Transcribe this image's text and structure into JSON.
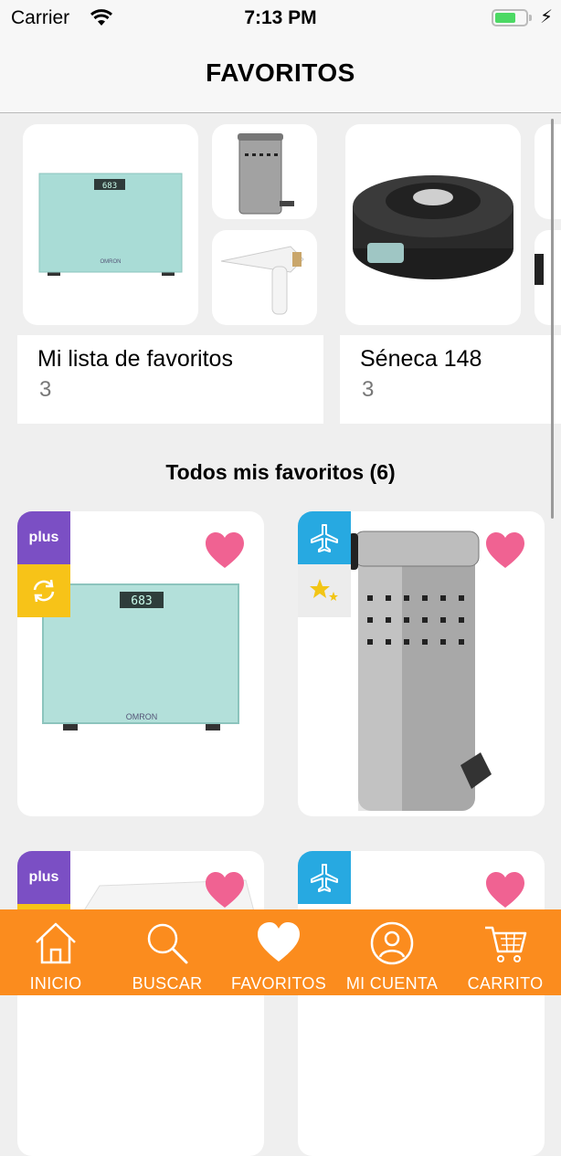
{
  "status": {
    "carrier": "Carrier",
    "time": "7:13 PM",
    "battery_level": 0.68
  },
  "header": {
    "title": "FAVORITOS"
  },
  "lists": [
    {
      "name": "Mi lista de favoritos",
      "count": "3"
    },
    {
      "name": "Séneca 148",
      "count": "3"
    }
  ],
  "section_title": "Todos mis favoritos (6)",
  "products": [
    {
      "badges": [
        "plus",
        "refresh-icon"
      ],
      "favorite": true,
      "image": "digital-bathroom-scale"
    },
    {
      "badges": [
        "airplane-icon",
        "stars-icon"
      ],
      "favorite": true,
      "image": "stainless-pedal-bin"
    },
    {
      "badges": [
        "plus"
      ],
      "favorite": true,
      "image": "plastic-container"
    },
    {
      "badges": [
        "airplane-icon"
      ],
      "favorite": true,
      "image": ""
    }
  ],
  "badge_labels": {
    "plus": "plus"
  },
  "scale_display": "683",
  "scale_brand": "OMRON",
  "tabs": [
    {
      "label": "INICIO",
      "icon": "home-icon"
    },
    {
      "label": "BUSCAR",
      "icon": "search-icon"
    },
    {
      "label": "FAVORITOS",
      "icon": "heart-icon"
    },
    {
      "label": "MI CUENTA",
      "icon": "user-icon"
    },
    {
      "label": "CARRITO",
      "icon": "cart-icon"
    }
  ],
  "colors": {
    "accent_orange": "#fb8c1e",
    "heart_pink": "#f06292",
    "plus_purple": "#7b4fc4",
    "refresh_yellow": "#f7c318",
    "plane_blue": "#27a9e1"
  }
}
